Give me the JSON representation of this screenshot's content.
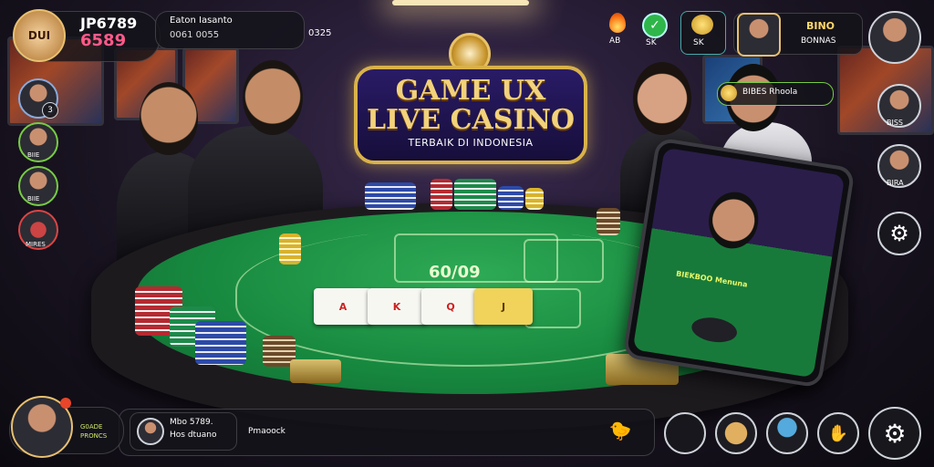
{
  "logo": {
    "line1": "GAME UX",
    "line2": "LIVE CASINO",
    "tagline": "TERBAIK DI INDONESIA"
  },
  "top_left": {
    "level_badge": "DUI",
    "jackpot_line1": "JP6789",
    "jackpot_line2": "6589",
    "info_line1": "Eaton Iasanto",
    "info_line2": "0061 0055",
    "extra": "0325"
  },
  "top_right": {
    "fire_label": "AB",
    "check_label": "SK",
    "coin_label": "SK",
    "player_name": "BINO",
    "player_sub": "BONNAS",
    "bonus_badge": "BIBES Rhoola"
  },
  "left_players": [
    {
      "name": "",
      "badge": "3"
    },
    {
      "name": "BIIE"
    },
    {
      "name": "BIIE"
    },
    {
      "name": "MIRES"
    }
  ],
  "right_players": [
    {
      "name": "BISS"
    },
    {
      "name": "BIRA"
    }
  ],
  "felt": {
    "center_text": "60/09"
  },
  "cards": [
    "A",
    "K",
    "Q",
    "J"
  ],
  "phone": {
    "overlay_text": "BIEKBOO Menuna"
  },
  "bottom_bar": {
    "profile_text1": "G0ADE",
    "profile_text2": "PRONCS",
    "id_line1": "Mbo 5789.",
    "id_line2": "Hos dtuano",
    "status": "Pmaoock"
  },
  "colors": {
    "felt": "#188a40",
    "gold": "#d9b24a",
    "logo_bg": "#1f145a"
  },
  "icons": [
    "settings-gear-icon",
    "fire-icon",
    "check-icon",
    "coin-icon",
    "chip-icon"
  ]
}
